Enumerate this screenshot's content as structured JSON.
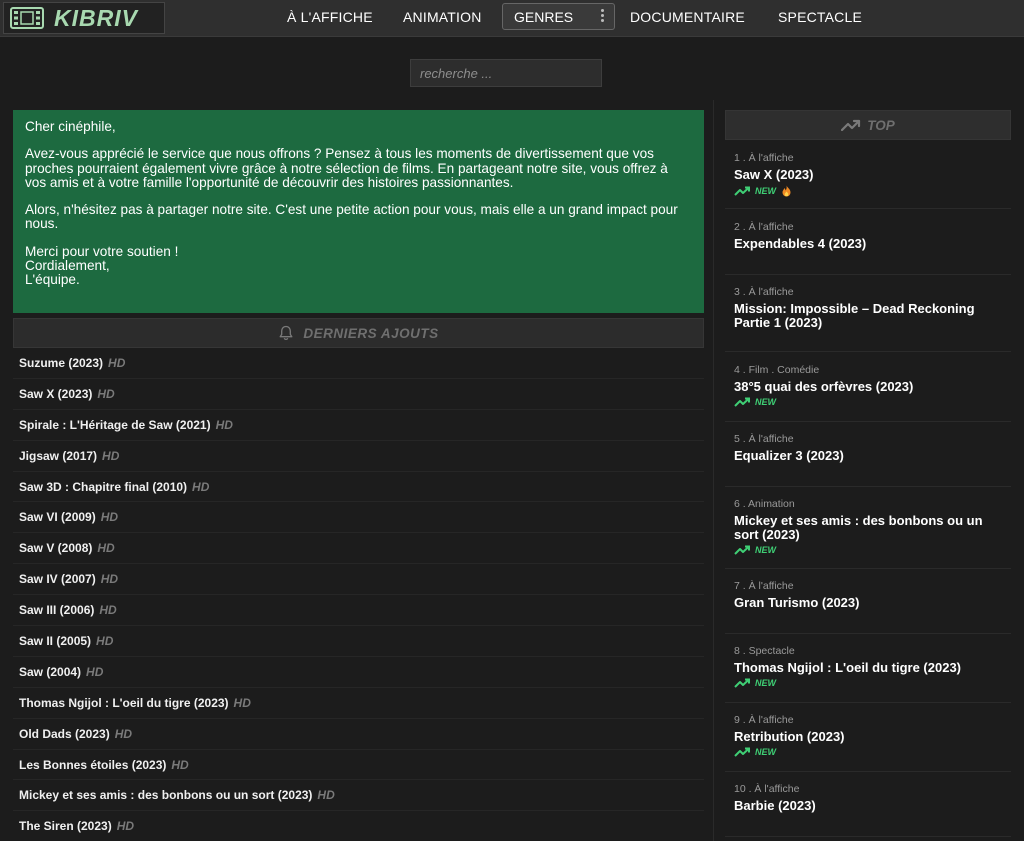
{
  "logo": {
    "text": "KIBRIV",
    "icon": "film-icon",
    "color": "#a8d9b0"
  },
  "nav": {
    "items": [
      "À L'AFFICHE",
      "ANIMATION",
      "GENRES",
      "DOCUMENTAIRE",
      "SPECTACLE"
    ]
  },
  "search": {
    "placeholder": "recherche ..."
  },
  "message": {
    "greeting": "Cher cinéphile,",
    "para1": "Avez-vous apprécié le service que nous offrons ? Pensez à tous les moments de divertissement que vos proches pourraient également vivre grâce à notre sélection de films. En partageant notre site, vous offrez à vos amis et à votre famille l'opportunité de découvrir des histoires passionnantes.",
    "para2": "Alors, n'hésitez pas à partager notre site. C'est une petite action pour vous, mais elle a un grand impact pour nous.",
    "sign1": "Merci pour votre soutien !",
    "sign2": "Cordialement,",
    "sign3": "L'équipe.",
    "background": "#1d6a40"
  },
  "latest": {
    "title": "DERNIERS AJOUTS",
    "hd_label": "HD",
    "items": [
      "Suzume (2023)",
      "Saw X (2023)",
      "Spirale : L'Héritage de Saw (2021)",
      "Jigsaw (2017)",
      "Saw 3D : Chapitre final (2010)",
      "Saw VI (2009)",
      "Saw V (2008)",
      "Saw IV (2007)",
      "Saw III (2006)",
      "Saw II (2005)",
      "Saw (2004)",
      "Thomas Ngijol : L'oeil du tigre (2023)",
      "Old Dads (2023)",
      "Les Bonnes étoiles (2023)",
      "Mickey et ses amis : des bonbons ou un sort (2023)",
      "The Siren (2023)"
    ]
  },
  "top": {
    "title": "TOP",
    "new_label": "NEW",
    "accent": "#3fcf75",
    "items": [
      {
        "meta": "1 . À l'affiche",
        "title": "Saw X (2023)",
        "new": true,
        "hot": true
      },
      {
        "meta": "2 . À l'affiche",
        "title": "Expendables 4 (2023)",
        "new": false,
        "hot": false
      },
      {
        "meta": "3 . À l'affiche",
        "title": "Mission: Impossible – Dead Reckoning Partie 1 (2023)",
        "new": false,
        "hot": false
      },
      {
        "meta": "4 . Film . Comédie",
        "title": "38°5 quai des orfèvres (2023)",
        "new": true,
        "hot": false
      },
      {
        "meta": "5 . À l'affiche",
        "title": "Equalizer 3 (2023)",
        "new": false,
        "hot": false
      },
      {
        "meta": "6 . Animation",
        "title": "Mickey et ses amis : des bonbons ou un sort (2023)",
        "new": true,
        "hot": false
      },
      {
        "meta": "7 . À l'affiche",
        "title": "Gran Turismo (2023)",
        "new": false,
        "hot": false
      },
      {
        "meta": "8 . Spectacle",
        "title": "Thomas Ngijol : L'oeil du tigre (2023)",
        "new": true,
        "hot": false
      },
      {
        "meta": "9 . À l'affiche",
        "title": "Retribution (2023)",
        "new": true,
        "hot": false
      },
      {
        "meta": "10 . À l'affiche",
        "title": "Barbie (2023)",
        "new": false,
        "hot": false
      }
    ]
  }
}
